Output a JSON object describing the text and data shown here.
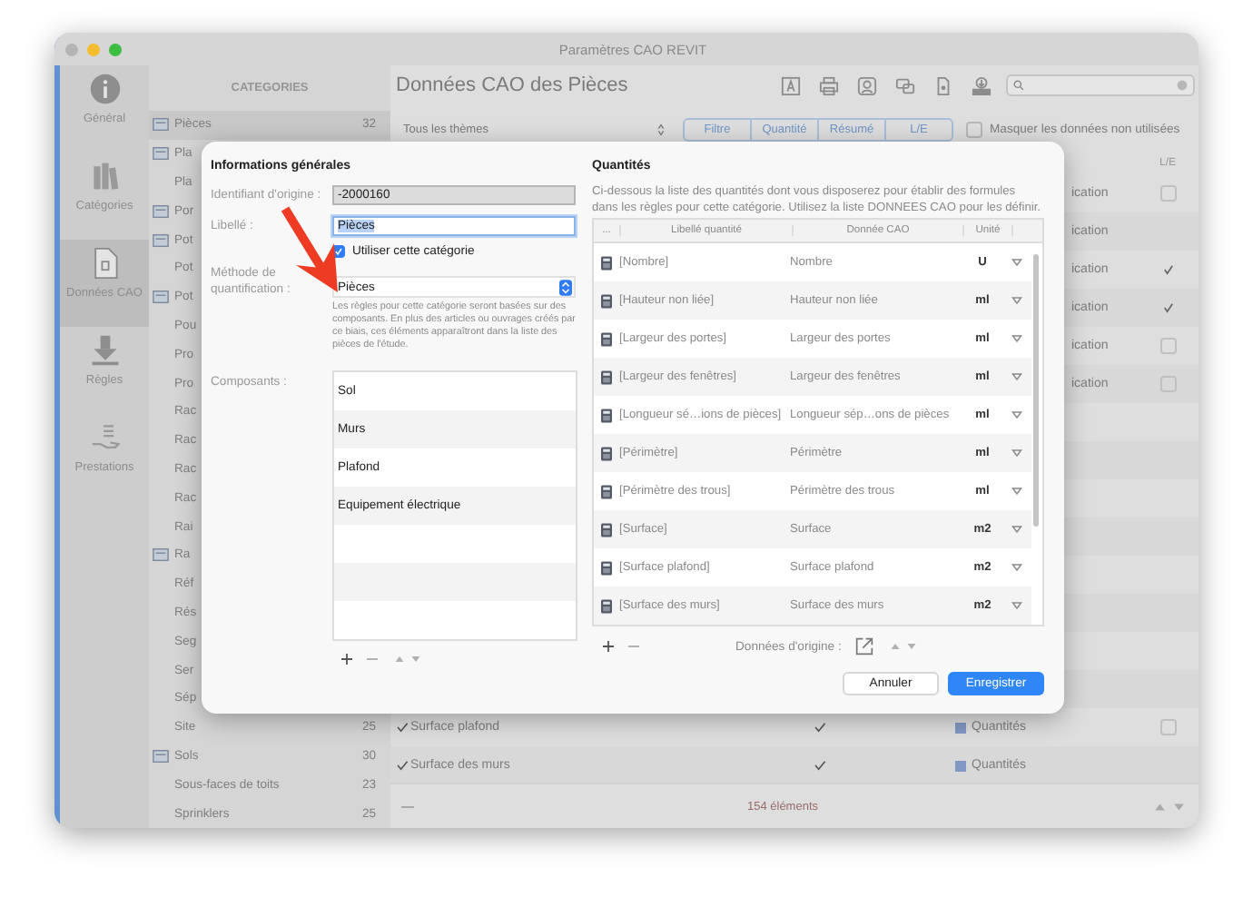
{
  "window": {
    "title": "Paramètres CAO REVIT"
  },
  "nav": [
    {
      "label": "Général",
      "selected": false
    },
    {
      "label": "Catégories",
      "selected": false
    },
    {
      "label": "Données CAO",
      "selected": true
    },
    {
      "label": "Règles",
      "selected": false
    },
    {
      "label": "Prestations",
      "selected": false
    }
  ],
  "categories": {
    "header": "CATEGORIES",
    "items": [
      {
        "label": "Pièces",
        "count": "32",
        "kind": "group",
        "selected": true
      },
      {
        "label": "Pla",
        "kind": "group",
        "selected": false
      },
      {
        "label": "Pla",
        "kind": "item",
        "selected": false
      },
      {
        "label": "Por",
        "kind": "group",
        "selected": false
      },
      {
        "label": "Pot",
        "kind": "group",
        "selected": false
      },
      {
        "label": "Pot",
        "kind": "item",
        "selected": false
      },
      {
        "label": "Pot",
        "kind": "group",
        "selected": false
      },
      {
        "label": "Pou",
        "kind": "item",
        "selected": false
      },
      {
        "label": "Pro",
        "kind": "item",
        "selected": false
      },
      {
        "label": "Pro",
        "kind": "item",
        "selected": false
      },
      {
        "label": "Rac",
        "kind": "item",
        "selected": false
      },
      {
        "label": "Rac",
        "kind": "item",
        "selected": false
      },
      {
        "label": "Rac",
        "kind": "item",
        "selected": false
      },
      {
        "label": "Rac",
        "kind": "item",
        "selected": false
      },
      {
        "label": "Rai",
        "kind": "item",
        "selected": false
      },
      {
        "label": "Ra",
        "kind": "group",
        "selected": false
      },
      {
        "label": "Réf",
        "kind": "item",
        "selected": false
      },
      {
        "label": "Rés",
        "kind": "item",
        "selected": false
      },
      {
        "label": "Seg",
        "kind": "item",
        "selected": false
      },
      {
        "label": "Ser",
        "kind": "item",
        "selected": false
      },
      {
        "label": "Sép",
        "kind": "item",
        "selected": false
      },
      {
        "label": "Site",
        "count": "25",
        "kind": "item",
        "selected": false
      },
      {
        "label": "Sols",
        "count": "30",
        "kind": "group",
        "selected": false
      },
      {
        "label": "Sous-faces de toits",
        "count": "23",
        "kind": "item",
        "selected": false
      },
      {
        "label": "Sprinklers",
        "count": "25",
        "kind": "item",
        "selected": false
      }
    ]
  },
  "main": {
    "title": "Données CAO des Pièces",
    "theme_select": "Tous les thèmes",
    "segments": [
      {
        "label": "Filtre",
        "selected": false
      },
      {
        "label": "Quantité",
        "selected": false
      },
      {
        "label": "Résumé",
        "selected": false
      },
      {
        "label": "L/E",
        "selected": false
      }
    ],
    "hide_unused": {
      "label": "Masquer les données non utilisées",
      "checked": false
    },
    "table": {
      "column_le": "L/E",
      "rows": [
        {
          "kind": "fragment",
          "text": "ication",
          "le": {
            "checked": false
          }
        },
        {
          "kind": "fragment",
          "text": "ication"
        },
        {
          "kind": "fragment",
          "text": "ication",
          "le": {
            "checked": true
          }
        },
        {
          "kind": "fragment",
          "text": "ication",
          "le": {
            "checked": true
          }
        },
        {
          "kind": "fragment",
          "text": "ication",
          "le": {
            "checked": false
          }
        },
        {
          "kind": "fragment",
          "text": "ication",
          "le": {
            "checked": false
          }
        },
        {
          "kind": "entry",
          "checked": true,
          "label": "Surface plafond",
          "used": true,
          "type": "Quantités",
          "le": {
            "checked": false
          }
        },
        {
          "kind": "entry",
          "checked": true,
          "label": "Surface des murs",
          "used": true,
          "type": "Quantités"
        }
      ]
    },
    "footer": "154 éléments"
  },
  "dialog": {
    "general": {
      "title": "Informations générales",
      "id_label": "Identifiant d'origine :",
      "id_value": "-2000160",
      "name_label": "Libellé :",
      "name_value": "Pièces",
      "use": {
        "label": "Utiliser cette catégorie",
        "checked": true
      },
      "method_label": "Méthode de quantification :",
      "method_value": "Pièces",
      "help": "Les règles pour cette catégorie seront basées sur des composants. En plus des articles ou ouvrages créés par ce biais, ces éléments apparaîtront dans la liste des pièces de l'étude.",
      "components_label": "Composants :",
      "components": [
        "Sol",
        "Murs",
        "Plafond",
        "Equipement électrique"
      ]
    },
    "quantities": {
      "title": "Quantités",
      "description": "Ci-dessous la liste des quantités dont vous disposerez pour établir des formules dans les règles pour cette catégorie. Utilisez la liste DONNEES CAO pour les définir.",
      "columns": [
        "...",
        "Libellé quantité",
        "Donnée CAO",
        "Unité"
      ],
      "rows": [
        {
          "label": "[Nombre]",
          "cad": "Nombre",
          "unit": "U"
        },
        {
          "label": "[Hauteur non liée]",
          "cad": "Hauteur non liée",
          "unit": "ml"
        },
        {
          "label": "[Largeur des portes]",
          "cad": "Largeur des portes",
          "unit": "ml"
        },
        {
          "label": "[Largeur des fenêtres]",
          "cad": "Largeur des fenêtres",
          "unit": "ml"
        },
        {
          "label": "[Longueur sé…ions de pièces]",
          "cad": "Longueur sép…ons de pièces",
          "unit": "ml"
        },
        {
          "label": "[Périmètre]",
          "cad": "Périmètre",
          "unit": "ml"
        },
        {
          "label": "[Périmètre des trous]",
          "cad": "Périmètre des trous",
          "unit": "ml"
        },
        {
          "label": "[Surface]",
          "cad": "Surface",
          "unit": "m2"
        },
        {
          "label": "[Surface plafond]",
          "cad": "Surface plafond",
          "unit": "m2"
        },
        {
          "label": "[Surface des murs]",
          "cad": "Surface des murs",
          "unit": "m2"
        }
      ],
      "origin_label": "Données d'origine :"
    },
    "buttons": {
      "cancel": "Annuler",
      "save": "Enregistrer"
    }
  }
}
